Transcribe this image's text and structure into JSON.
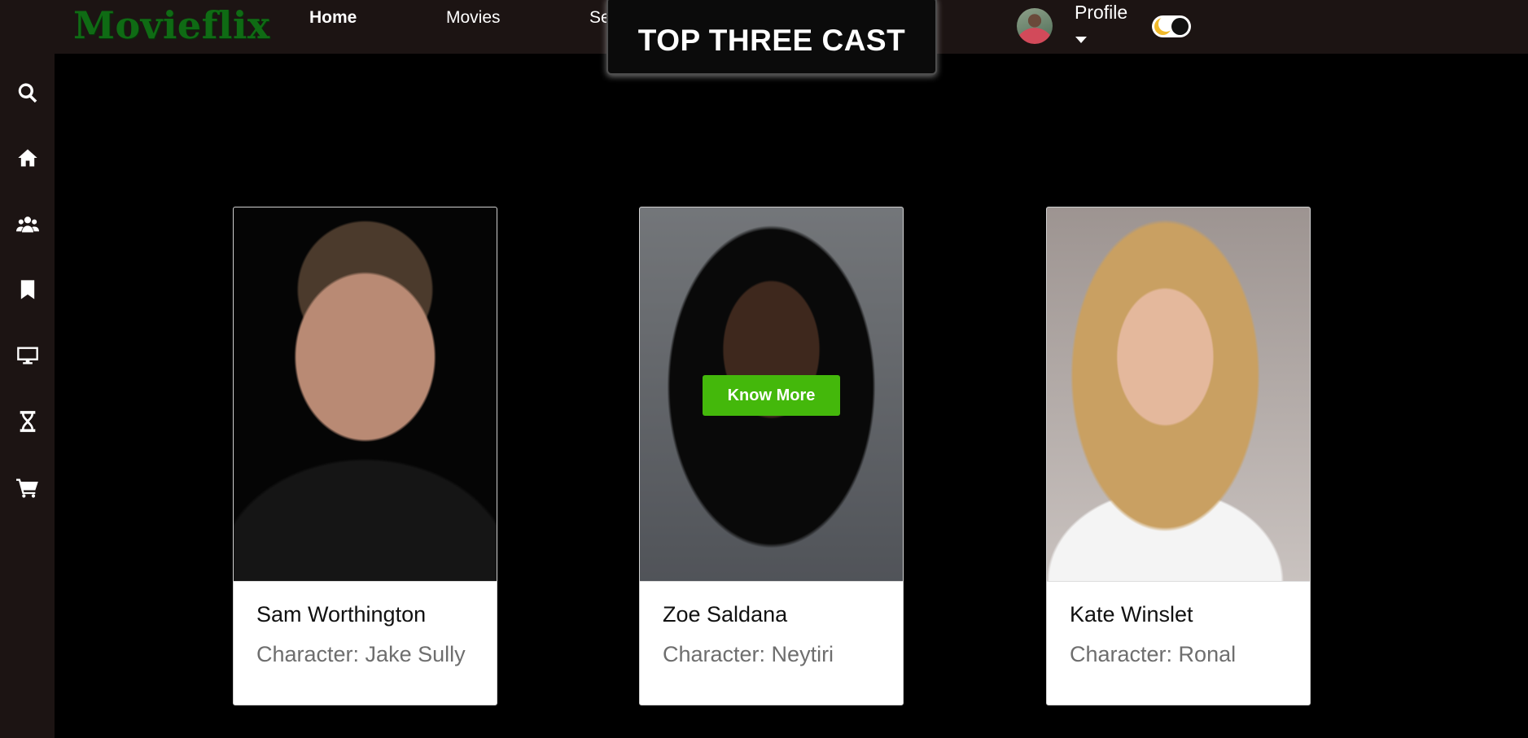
{
  "app": {
    "logo": "Movieflix"
  },
  "nav": {
    "home": "Home",
    "movies": "Movies",
    "series_partial": "Series"
  },
  "section_title": "TOP THREE CAST",
  "profile": {
    "label": "Profile"
  },
  "theme_toggle": {
    "state": "dark",
    "icon": "moon-icon"
  },
  "sidebar": {
    "items": [
      {
        "icon": "search-icon"
      },
      {
        "icon": "home-icon"
      },
      {
        "icon": "users-icon"
      },
      {
        "icon": "bookmark-icon"
      },
      {
        "icon": "tv-icon"
      },
      {
        "icon": "hourglass-icon"
      },
      {
        "icon": "cart-icon"
      }
    ]
  },
  "cast": [
    {
      "name": "Sam Worthington",
      "character": "Character: Jake Sully"
    },
    {
      "name": "Zoe Saldana",
      "character": "Character: Neytiri",
      "hover_button": "Know More"
    },
    {
      "name": "Kate Winslet",
      "character": "Character: Ronal"
    }
  ],
  "colors": {
    "bar_bg": "#1c1413",
    "logo": "#0f6b14",
    "button": "#44b80b",
    "page_bg": "#000000"
  }
}
